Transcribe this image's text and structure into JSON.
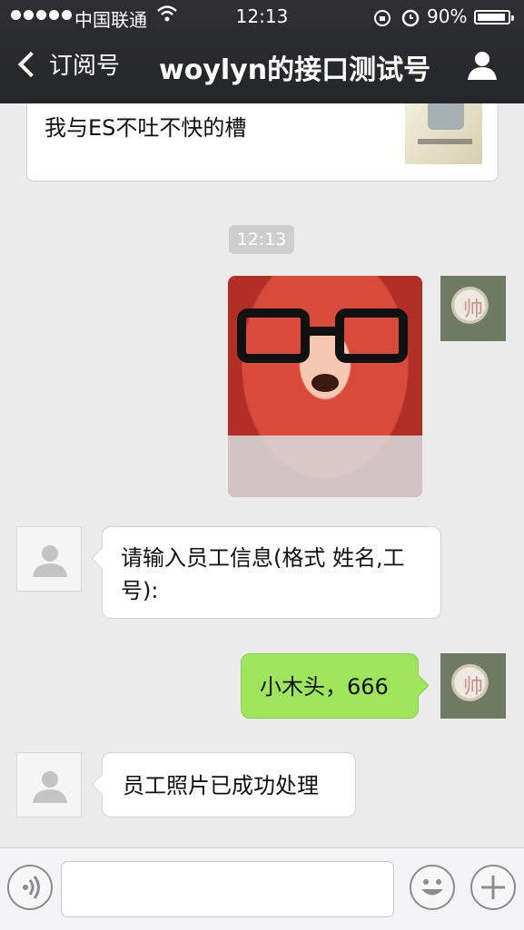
{
  "status_bar": {
    "carrier": "中国联通",
    "time": "12:13",
    "battery": "90%",
    "battery_level": 0.9
  },
  "nav": {
    "back_label": "订阅号",
    "title": "woylyn的接口测试号"
  },
  "article": {
    "title": "我与ES不吐不快的槽"
  },
  "timestamp": "12:13",
  "user_avatar_glyph": "帅",
  "messages": [
    {
      "from": "bot",
      "text": "请输入员工信息(格式 姓名,工号):"
    },
    {
      "from": "me",
      "text": "小木头，666"
    },
    {
      "from": "bot",
      "text": "员工照片已成功处理"
    }
  ],
  "input": {
    "placeholder": ""
  },
  "colors": {
    "nav_bg": "#2a2b2f",
    "out_bubble": "#9fe55b",
    "chat_bg": "#ebebeb"
  }
}
